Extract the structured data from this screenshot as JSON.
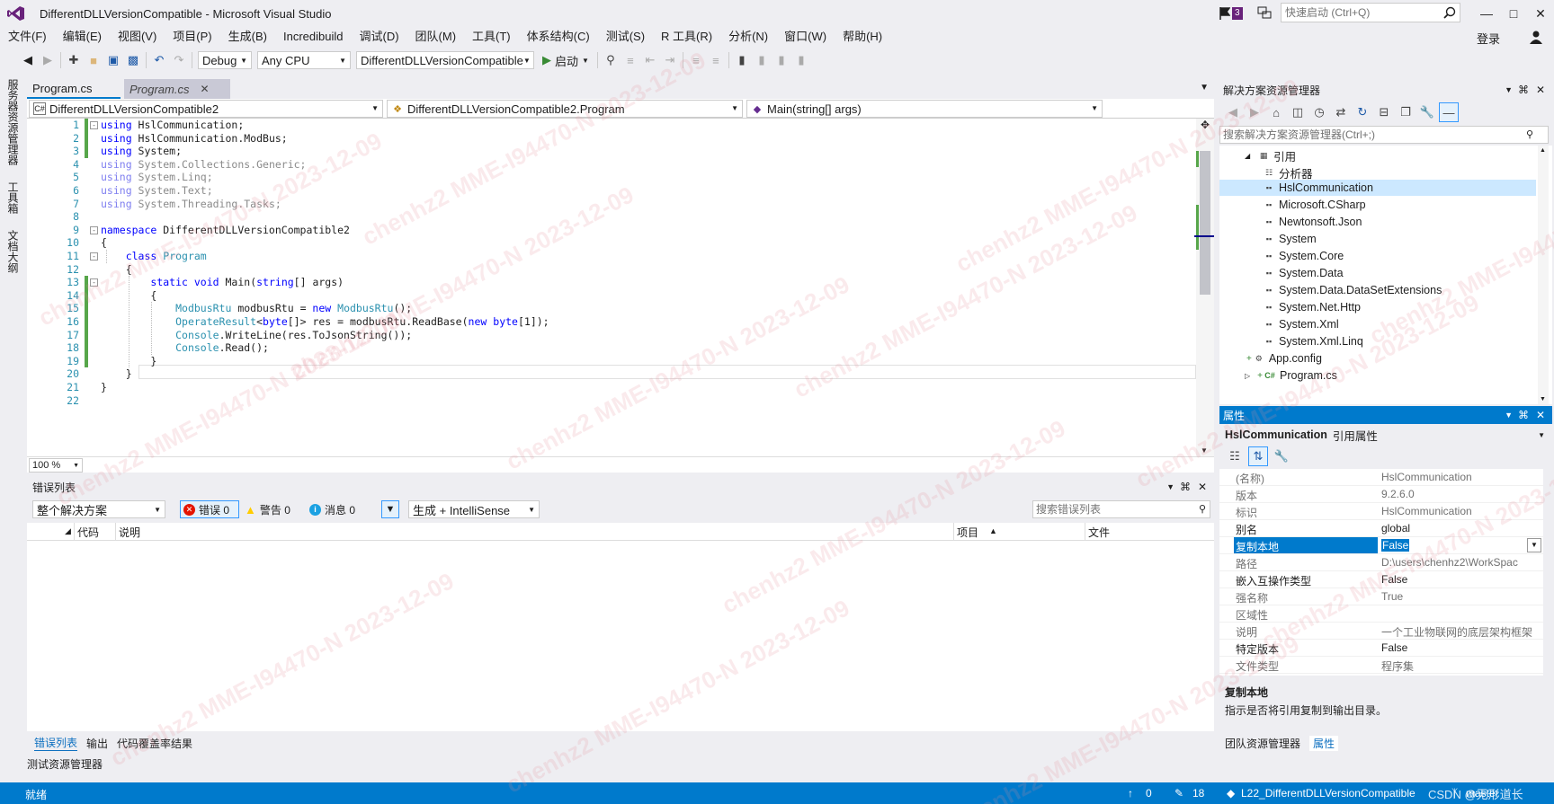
{
  "window": {
    "title": "DifferentDLLVersionCompatible - Microsoft Visual Studio",
    "notification_count": "3",
    "quick_launch_placeholder": "快速启动 (Ctrl+Q)",
    "sign_in": "登录"
  },
  "menu": [
    "文件(F)",
    "编辑(E)",
    "视图(V)",
    "项目(P)",
    "生成(B)",
    "Incredibuild",
    "调试(D)",
    "团队(M)",
    "工具(T)",
    "体系结构(C)",
    "测试(S)",
    "R 工具(R)",
    "分析(N)",
    "窗口(W)",
    "帮助(H)"
  ],
  "toolbar": {
    "config": "Debug",
    "platform": "Any CPU",
    "startup_project": "DifferentDLLVersionCompatible",
    "start_label": "启动"
  },
  "side_tabs": [
    "服务器资源管理器",
    "工具箱",
    "文档大纲"
  ],
  "doc_tabs": [
    "Program.cs",
    "Program.cs"
  ],
  "navbar": {
    "project": "DifferentDLLVersionCompatible2",
    "type": "DifferentDLLVersionCompatible2.Program",
    "member": "Main(string[] args)"
  },
  "code": {
    "line_numbers": [
      "1",
      "2",
      "3",
      "4",
      "5",
      "6",
      "7",
      "8",
      "9",
      "10",
      "11",
      "12",
      "13",
      "14",
      "15",
      "16",
      "17",
      "18",
      "19",
      "20",
      "21",
      "22"
    ],
    "lines": [
      [
        [
          "kw",
          "using"
        ],
        [
          "t",
          " HslCommunication;"
        ]
      ],
      [
        [
          "kw",
          "using"
        ],
        [
          "t",
          " HslCommunication.ModBus;"
        ]
      ],
      [
        [
          "kw",
          "using"
        ],
        [
          "t",
          " System;"
        ]
      ],
      [
        [
          "fk",
          "using"
        ],
        [
          "f",
          " System.Collections.Generic;"
        ]
      ],
      [
        [
          "fk",
          "using"
        ],
        [
          "f",
          " System.Linq;"
        ]
      ],
      [
        [
          "fk",
          "using"
        ],
        [
          "f",
          " System.Text;"
        ]
      ],
      [
        [
          "fk",
          "using"
        ],
        [
          "f",
          " System.Threading.Tasks;"
        ]
      ],
      [],
      [
        [
          "kw",
          "namespace"
        ],
        [
          "t",
          " DifferentDLLVersionCompatible2"
        ]
      ],
      [
        [
          "t",
          "{"
        ]
      ],
      [
        [
          "t",
          "    "
        ],
        [
          "kw",
          "class"
        ],
        [
          "t",
          " "
        ],
        [
          "ty",
          "Program"
        ]
      ],
      [
        [
          "t",
          "    {"
        ]
      ],
      [
        [
          "t",
          "        "
        ],
        [
          "kw",
          "static"
        ],
        [
          "t",
          " "
        ],
        [
          "kw",
          "void"
        ],
        [
          "t",
          " Main("
        ],
        [
          "kw",
          "string"
        ],
        [
          "t",
          "[] args)"
        ]
      ],
      [
        [
          "t",
          "        {"
        ]
      ],
      [
        [
          "t",
          "            "
        ],
        [
          "ty",
          "ModbusRtu"
        ],
        [
          "t",
          " modbusRtu = "
        ],
        [
          "kw",
          "new"
        ],
        [
          "t",
          " "
        ],
        [
          "ty",
          "ModbusRtu"
        ],
        [
          "t",
          "();"
        ]
      ],
      [
        [
          "t",
          "            "
        ],
        [
          "ty",
          "OperateResult"
        ],
        [
          "t",
          "<"
        ],
        [
          "kw",
          "byte"
        ],
        [
          "t",
          "[]> res = modbusRtu.ReadBase("
        ],
        [
          "kw",
          "new"
        ],
        [
          "t",
          " "
        ],
        [
          "kw",
          "byte"
        ],
        [
          "t",
          "[1]);"
        ]
      ],
      [
        [
          "t",
          "            "
        ],
        [
          "ty",
          "Console"
        ],
        [
          "t",
          ".WriteLine(res.ToJsonString());"
        ]
      ],
      [
        [
          "t",
          "            "
        ],
        [
          "ty",
          "Console"
        ],
        [
          "t",
          ".Read();"
        ]
      ],
      [
        [
          "t",
          "        }"
        ]
      ],
      [
        [
          "t",
          "    }"
        ]
      ],
      [
        [
          "t",
          "}"
        ]
      ],
      []
    ]
  },
  "zoom": "100 %",
  "error_list": {
    "title": "错误列表",
    "scope": "整个解决方案",
    "errors": "错误 0",
    "warnings": "警告 0",
    "messages": "消息 0",
    "source": "生成 + IntelliSense",
    "search_placeholder": "搜索错误列表",
    "columns": [
      "代码",
      "说明",
      "项目",
      "文件"
    ]
  },
  "bottom_tabs": [
    "错误列表",
    "输出",
    "代码覆盖率结果"
  ],
  "test_explorer": "测试资源管理器",
  "solution_explorer": {
    "title": "解决方案资源管理器",
    "search_placeholder": "搜索解决方案资源管理器(Ctrl+;)",
    "items": [
      {
        "label": "引用",
        "indent": 1
      },
      {
        "label": "分析器",
        "indent": 2
      },
      {
        "label": "HslCommunication",
        "indent": 2
      },
      {
        "label": "Microsoft.CSharp",
        "indent": 2
      },
      {
        "label": "Newtonsoft.Json",
        "indent": 2
      },
      {
        "label": "System",
        "indent": 2
      },
      {
        "label": "System.Core",
        "indent": 2
      },
      {
        "label": "System.Data",
        "indent": 2
      },
      {
        "label": "System.Data.DataSetExtensions",
        "indent": 2
      },
      {
        "label": "System.Net.Http",
        "indent": 2
      },
      {
        "label": "System.Xml",
        "indent": 2
      },
      {
        "label": "System.Xml.Linq",
        "indent": 2
      },
      {
        "label": "App.config",
        "indent": 1
      },
      {
        "label": "Program.cs",
        "indent": 1
      }
    ],
    "selected_index": 2
  },
  "properties": {
    "title": "属性",
    "object": "HslCommunication",
    "object_type": "引用属性",
    "rows": [
      {
        "name": "(名称)",
        "value": "HslCommunication",
        "readonly": true
      },
      {
        "name": "版本",
        "value": "9.2.6.0",
        "readonly": true
      },
      {
        "name": "标识",
        "value": "HslCommunication",
        "readonly": true
      },
      {
        "name": "别名",
        "value": "global",
        "readonly": false
      },
      {
        "name": "复制本地",
        "value": "False",
        "readonly": false
      },
      {
        "name": "路径",
        "value": "D:\\users\\chenhz2\\WorkSpac",
        "readonly": true
      },
      {
        "name": "嵌入互操作类型",
        "value": "False",
        "readonly": false
      },
      {
        "name": "强名称",
        "value": "True",
        "readonly": true
      },
      {
        "name": "区域性",
        "value": "",
        "readonly": true
      },
      {
        "name": "说明",
        "value": "一个工业物联网的底层架构框架",
        "readonly": true
      },
      {
        "name": "特定版本",
        "value": "False",
        "readonly": false
      },
      {
        "name": "文件类型",
        "value": "程序集",
        "readonly": true
      }
    ],
    "selected_index": 4,
    "desc_title": "复制本地",
    "desc_text": "指示是否将引用复制到输出目录。"
  },
  "right_bottom_tabs": [
    "团队资源管理器",
    "属性"
  ],
  "statusbar": {
    "ready": "就绪",
    "pending_up": "0",
    "pending_edits": "18",
    "branch_repo": "L22_DifferentDLLVersionCompatible",
    "branch": "master"
  },
  "watermark": "chenhz2 MME-I94470-N 2023-12-09",
  "csdn_mark": "CSDN @无形道长",
  "colors": {
    "accent": "#007acc",
    "keyword": "#0000ff",
    "type": "#2b91af",
    "change_bar": "#57a64a",
    "notification": "#68217a"
  }
}
